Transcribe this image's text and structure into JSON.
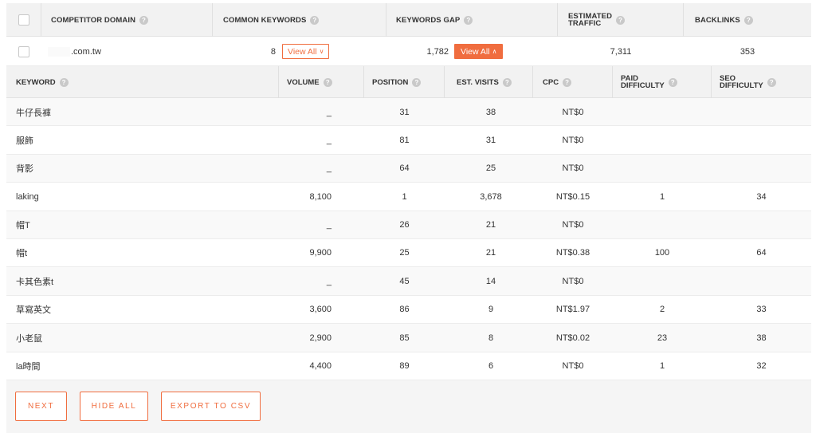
{
  "competitors": {
    "headers": {
      "domain": "COMPETITOR DOMAIN",
      "common_keywords": "COMMON KEYWORDS",
      "keywords_gap": "KEYWORDS GAP",
      "estimated_traffic_line1": "ESTIMATED",
      "estimated_traffic_line2": "TRAFFIC",
      "backlinks": "BACKLINKS"
    },
    "row": {
      "domain": ".com.tw",
      "common_keywords": "8",
      "view_all_label": "View All",
      "keywords_gap": "1,782",
      "view_all_active_label": "View All",
      "estimated_traffic": "7,311",
      "backlinks": "353"
    }
  },
  "keywords": {
    "headers": {
      "keyword": "KEYWORD",
      "volume": "VOLUME",
      "position": "POSITION",
      "est_visits": "EST. VISITS",
      "cpc": "CPC",
      "paid_line1": "PAID",
      "paid_line2": "DIFFICULTY",
      "seo_line1": "SEO",
      "seo_line2": "DIFFICULTY"
    },
    "rows": [
      {
        "keyword": "牛仔長褲",
        "volume": "_",
        "position": "31",
        "visits": "38",
        "cpc": "NT$0",
        "paid": "",
        "seo": ""
      },
      {
        "keyword": "服飾",
        "volume": "_",
        "position": "81",
        "visits": "31",
        "cpc": "NT$0",
        "paid": "",
        "seo": ""
      },
      {
        "keyword": "背影",
        "volume": "_",
        "position": "64",
        "visits": "25",
        "cpc": "NT$0",
        "paid": "",
        "seo": ""
      },
      {
        "keyword": "laking",
        "volume": "8,100",
        "position": "1",
        "visits": "3,678",
        "cpc": "NT$0.15",
        "paid": "1",
        "seo": "34"
      },
      {
        "keyword": "帽T",
        "volume": "_",
        "position": "26",
        "visits": "21",
        "cpc": "NT$0",
        "paid": "",
        "seo": ""
      },
      {
        "keyword": "帽t",
        "volume": "9,900",
        "position": "25",
        "visits": "21",
        "cpc": "NT$0.38",
        "paid": "100",
        "seo": "64"
      },
      {
        "keyword": "卡其色素t",
        "volume": "_",
        "position": "45",
        "visits": "14",
        "cpc": "NT$0",
        "paid": "",
        "seo": ""
      },
      {
        "keyword": "草寫英文",
        "volume": "3,600",
        "position": "86",
        "visits": "9",
        "cpc": "NT$1.97",
        "paid": "2",
        "seo": "33"
      },
      {
        "keyword": "小老鼠",
        "volume": "2,900",
        "position": "85",
        "visits": "8",
        "cpc": "NT$0.02",
        "paid": "23",
        "seo": "38"
      },
      {
        "keyword": "la時間",
        "volume": "4,400",
        "position": "89",
        "visits": "6",
        "cpc": "NT$0",
        "paid": "1",
        "seo": "32"
      }
    ]
  },
  "actions": {
    "next": "NEXT",
    "hide_all": "HIDE ALL",
    "export": "EXPORT TO CSV"
  },
  "colors": {
    "accent": "#f06d3f",
    "header_bg": "#f2f2f2"
  },
  "icons": {
    "help": "question-circle-icon",
    "chevron_down": "chevron-down-icon",
    "chevron_up": "chevron-up-icon"
  }
}
